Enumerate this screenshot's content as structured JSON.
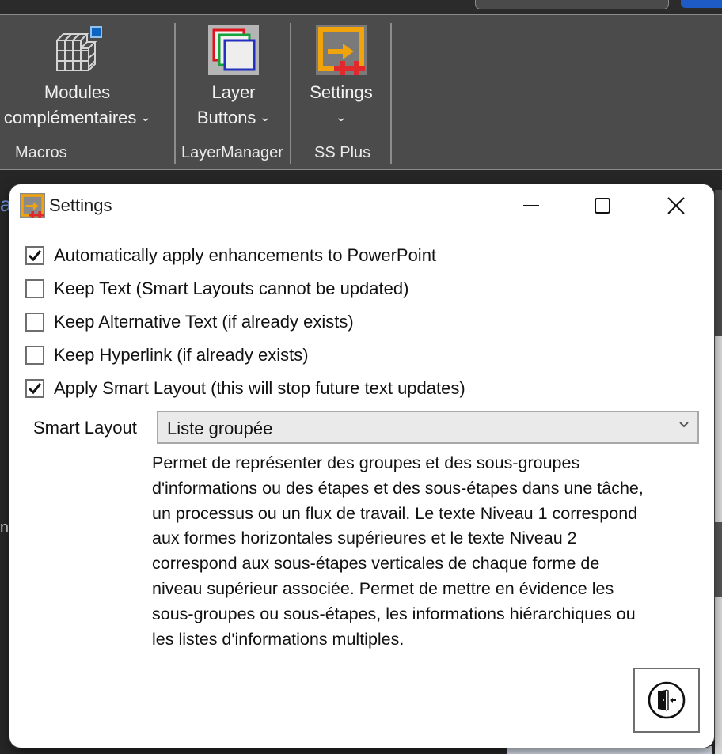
{
  "ribbon": {
    "buttons": [
      {
        "id": "modules",
        "line1": "Modules",
        "line2": "complémentaires",
        "icon": "addins-cube-icon",
        "has_dropdown": true
      },
      {
        "id": "layer-buttons",
        "line1": "Layer",
        "line2": "Buttons",
        "icon": "layers-icon",
        "has_dropdown": true
      },
      {
        "id": "settings",
        "line1": "Settings",
        "line2": "",
        "icon": "ss-plus-settings-icon",
        "has_dropdown": true
      }
    ],
    "groups": [
      "Macros",
      "LayerManager",
      "SS Plus"
    ],
    "dropdown_glyph": "⌄"
  },
  "background": {
    "left_fragment_1": "a",
    "left_fragment_2": "n"
  },
  "dialog": {
    "title": "Settings",
    "icon": "ss-plus-settings-icon",
    "controls": {
      "minimize": "minimize-icon",
      "maximize": "maximize-icon",
      "close": "close-icon"
    },
    "checkboxes": [
      {
        "label": "Automatically apply enhancements to PowerPoint",
        "checked": true
      },
      {
        "label": "Keep Text (Smart Layouts cannot be updated)",
        "checked": false
      },
      {
        "label": "Keep Alternative Text (if already exists)",
        "checked": false
      },
      {
        "label": "Keep Hyperlink (if already exists)",
        "checked": false
      },
      {
        "label": "Apply Smart Layout (this will stop future text updates)",
        "checked": true
      }
    ],
    "smart_layout": {
      "label": "Smart Layout",
      "selected": "Liste groupée"
    },
    "description_lines": [
      "Permet de représenter des groupes et des sous-groupes",
      "d'informations ou des étapes et des sous-étapes dans une tâche,",
      "un processus ou un flux de travail. Le texte Niveau 1 correspond",
      "aux formes horizontales supérieures et le texte Niveau 2",
      "correspond aux sous-étapes verticales de chaque forme de",
      "niveau supérieur associée. Permet de mettre en évidence les",
      "sous-groupes ou sous-étapes, les informations hiérarchiques ou",
      "les listes d'informations multiples."
    ],
    "exit_button": {
      "icon": "exit-door-icon"
    }
  },
  "colors": {
    "ribbon_bg": "#4b4b4b",
    "accent_orange": "#f0a30a",
    "accent_red": "#e0282d",
    "accent_blue": "#1f5bc6"
  }
}
